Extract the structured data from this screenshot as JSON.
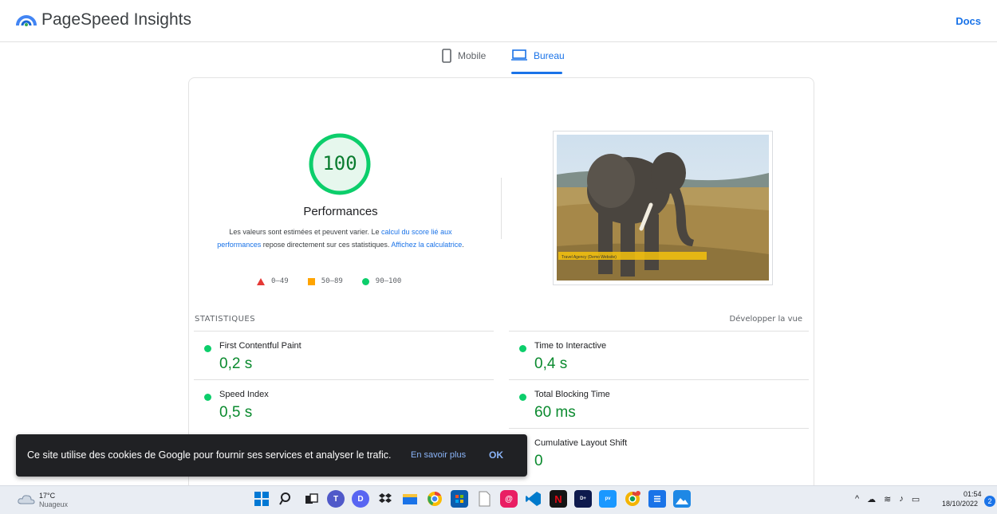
{
  "header": {
    "brand": "PageSpeed Insights",
    "docs_label": "Docs"
  },
  "tabs": [
    {
      "label": "Mobile",
      "icon": "phone-icon",
      "active": false
    },
    {
      "label": "Bureau",
      "icon": "laptop-icon",
      "active": true
    }
  ],
  "performance": {
    "score": "100",
    "title": "Performances",
    "desc_part1": "Les valeurs sont estimées et peuvent varier. Le ",
    "link_calc": "calcul du score lié aux performances",
    "desc_part2": " repose directement sur ces statistiques. ",
    "link_show": "Affichez la calculatrice",
    "desc_end": ".",
    "legend": [
      {
        "range": "0–49",
        "shape": "triangle",
        "color": "#e53935"
      },
      {
        "range": "50–89",
        "shape": "square",
        "color": "#ffa400"
      },
      {
        "range": "90–100",
        "shape": "circle",
        "color": "#0cce6b"
      }
    ]
  },
  "screenshot": {
    "caption": "Travel Agency (Demo Website)"
  },
  "stats": {
    "heading": "STATISTIQUES",
    "expand_label": "Développer la vue",
    "metrics": [
      {
        "label": "First Contentful Paint",
        "value": "0,2 s"
      },
      {
        "label": "Time to Interactive",
        "value": "0,4 s"
      },
      {
        "label": "Speed Index",
        "value": "0,5 s"
      },
      {
        "label": "Total Blocking Time",
        "value": "60 ms"
      },
      {
        "label": "Cumulative Layout Shift",
        "value": "0"
      }
    ]
  },
  "cookie": {
    "text": "Ce site utilise des cookies de Google pour fournir ses services et analyser le trafic.",
    "more_label": "En savoir plus",
    "ok_label": "OK"
  },
  "taskbar": {
    "temperature": "17°C",
    "condition": "Nuageux",
    "time": "01:54",
    "date": "18/10/2022",
    "notifications": "2",
    "apps": [
      "windows-start-icon",
      "search-icon",
      "task-view-icon",
      "teams-icon",
      "discord-icon",
      "dropbox-icon",
      "file-explorer-icon",
      "chrome-icon",
      "store-icon",
      "notepad-icon",
      "app-icon",
      "vscode-icon",
      "netflix-icon",
      "disney-plus-icon",
      "prime-video-icon",
      "chrome-canary-icon",
      "notes-icon",
      "photos-icon"
    ]
  },
  "colors": {
    "accent": "#1a73e8",
    "pass": "#0cce6b",
    "score_text": "#0a7c2f"
  }
}
